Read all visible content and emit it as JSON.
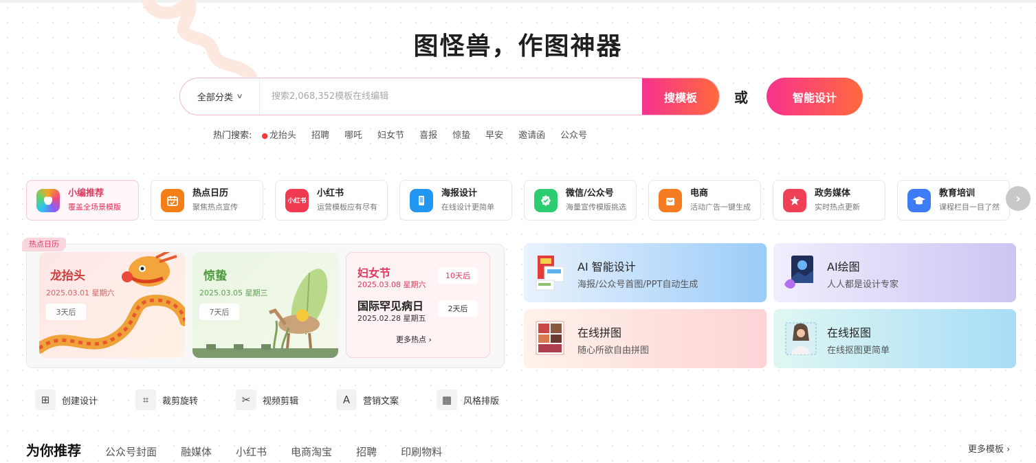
{
  "hero": {
    "title": "图怪兽，作图神器"
  },
  "search": {
    "category": "全部分类",
    "placeholder": "搜索2,068,352模板在线编辑",
    "button": "搜模板",
    "or_text": "或",
    "smart_button": "智能设计"
  },
  "hot_search": {
    "label": "热门搜索:",
    "items": [
      "龙抬头",
      "招聘",
      "哪吒",
      "妇女节",
      "喜报",
      "惊蛰",
      "早安",
      "邀请函",
      "公众号"
    ]
  },
  "categories": [
    {
      "title": "小编推荐",
      "sub": "覆盖全场景模版",
      "icon": "apple-icon",
      "color": "#f5a623"
    },
    {
      "title": "热点日历",
      "sub": "聚焦热点宣传",
      "icon": "calendar-icon",
      "color": "#f57f17"
    },
    {
      "title": "小红书",
      "sub": "运营模板应有尽有",
      "icon": "xiaohongshu-icon",
      "color": "#ef3a4f",
      "icon_text": "小红书"
    },
    {
      "title": "海报设计",
      "sub": "在线设计更简单",
      "icon": "phone-icon",
      "color": "#2196f3"
    },
    {
      "title": "微信/公众号",
      "sub": "海量宣传模版挑选",
      "icon": "wechat-icon",
      "color": "#2ecc71"
    },
    {
      "title": "电商",
      "sub": "活动广告一键生成",
      "icon": "shopping-bag-icon",
      "color": "#f57c20"
    },
    {
      "title": "政务媒体",
      "sub": "实时热点更新",
      "icon": "star-icon",
      "color": "#ef4056"
    },
    {
      "title": "教育培训",
      "sub": "课程栏目一目了然",
      "icon": "graduation-cap-icon",
      "color": "#3d7cf5"
    }
  ],
  "next_arrow": "›",
  "hot_calendar": {
    "tag": "热点日历",
    "dragon": {
      "name": "龙抬头",
      "date": "2025.03.01 星期六",
      "days": "3天后"
    },
    "jingzhe": {
      "name": "惊蛰",
      "date": "2025.03.05 星期三",
      "days": "7天后"
    },
    "list": {
      "name1": "妇女节",
      "date1": "2025.03.08 星期六",
      "days1": "10天后",
      "name2": "国际罕见病日",
      "date2": "2025.02.28 星期五",
      "days2": "2天后",
      "more": "更多热点 ›"
    }
  },
  "features": [
    {
      "title": "AI 智能设计",
      "sub": "海报/公众号首图/PPT自动生成"
    },
    {
      "title": "AI绘图",
      "sub": "人人都是设计专家"
    },
    {
      "title": "在线拼图",
      "sub": "随心所欲自由拼图"
    },
    {
      "title": "在线抠图",
      "sub": "在线抠图更简单"
    }
  ],
  "tools": [
    {
      "label": "创建设计",
      "icon": "create-design-icon",
      "glyph": "⊞"
    },
    {
      "label": "裁剪旋转",
      "icon": "crop-icon",
      "glyph": "⌗"
    },
    {
      "label": "视频剪辑",
      "icon": "scissors-icon",
      "glyph": "✂"
    },
    {
      "label": "营销文案",
      "icon": "text-ad-icon",
      "glyph": "A"
    },
    {
      "label": "风格排版",
      "icon": "layout-icon",
      "glyph": "▦"
    }
  ],
  "recommend": {
    "title": "为你推荐",
    "tabs": [
      "公众号封面",
      "融媒体",
      "小红书",
      "电商淘宝",
      "招聘",
      "印刷物料"
    ],
    "more": "更多模板 ›"
  },
  "colors": {
    "brand_gradient_start": "#f7328f",
    "brand_gradient_end": "#ff6a3d",
    "accent_red": "#e0375e"
  }
}
